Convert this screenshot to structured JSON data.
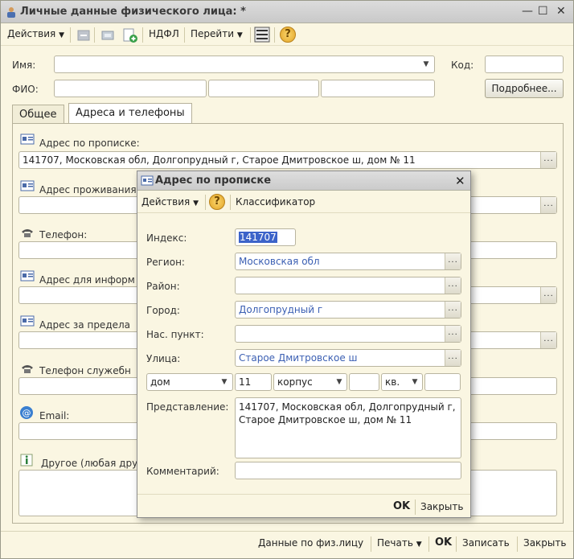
{
  "window": {
    "title": "Личные данные физического лица: *",
    "controls": {
      "minimize": "—",
      "maximize": "☐",
      "close": "✕"
    }
  },
  "toolbar": {
    "actions_label": "Действия",
    "ndfl_label": "НДФЛ",
    "goto_label": "Перейти",
    "help_label": "?"
  },
  "header_form": {
    "name_label": "Имя:",
    "name_value": "",
    "code_label": "Код:",
    "code_value": "",
    "fio_label": "ФИО:",
    "fio_values": [
      "",
      "",
      ""
    ],
    "details_button": "Подробнее..."
  },
  "tabs": [
    {
      "label": "Общее",
      "active": false
    },
    {
      "label": "Адреса и телефоны",
      "active": true
    }
  ],
  "contacts": {
    "reg_address_label": "Адрес по прописке:",
    "reg_address_value": "141707, Московская обл, Долгопрудный г, Старое Дмитровское ш, дом № 11",
    "live_address_label": "Адрес проживания",
    "live_address_value": "",
    "phone_label": "Телефон:",
    "phone_value": "",
    "info_address_label": "Адрес для информ",
    "info_address_value": "",
    "abroad_address_label": "Адрес за предела",
    "abroad_address_value": "",
    "work_phone_label": "Телефон служебн",
    "work_phone_value": "",
    "email_label": "Email:",
    "email_value": "",
    "other_label": "Другое (любая дру",
    "other_value": ""
  },
  "dialog": {
    "title": "Адрес по прописке",
    "close": "✕",
    "actions_label": "Действия",
    "help_label": "?",
    "classifier_label": "Классификатор",
    "fields": {
      "index_label": "Индекс:",
      "index_value": "141707",
      "region_label": "Регион:",
      "region_value": "Московская обл",
      "district_label": "Район:",
      "district_value": "",
      "city_label": "Город:",
      "city_value": "Долгопрудный г",
      "settlement_label": "Нас. пункт:",
      "settlement_value": "",
      "street_label": "Улица:",
      "street_value": "Старое Дмитровское ш",
      "house_type": "дом",
      "house_value": "11",
      "building_type": "корпус",
      "building_value": "",
      "flat_type": "кв.",
      "flat_value": "",
      "representation_label": "Представление:",
      "representation_value": "141707, Московская обл, Долгопрудный г, Старое Дмитровское ш, дом № 11",
      "comment_label": "Комментарий:",
      "comment_value": ""
    },
    "ok_label": "OK",
    "close_label": "Закрыть"
  },
  "bottom": {
    "person_data_label": "Данные по физ.лицу",
    "print_label": "Печать",
    "ok_label": "OK",
    "save_label": "Записать",
    "close_label": "Закрыть"
  }
}
